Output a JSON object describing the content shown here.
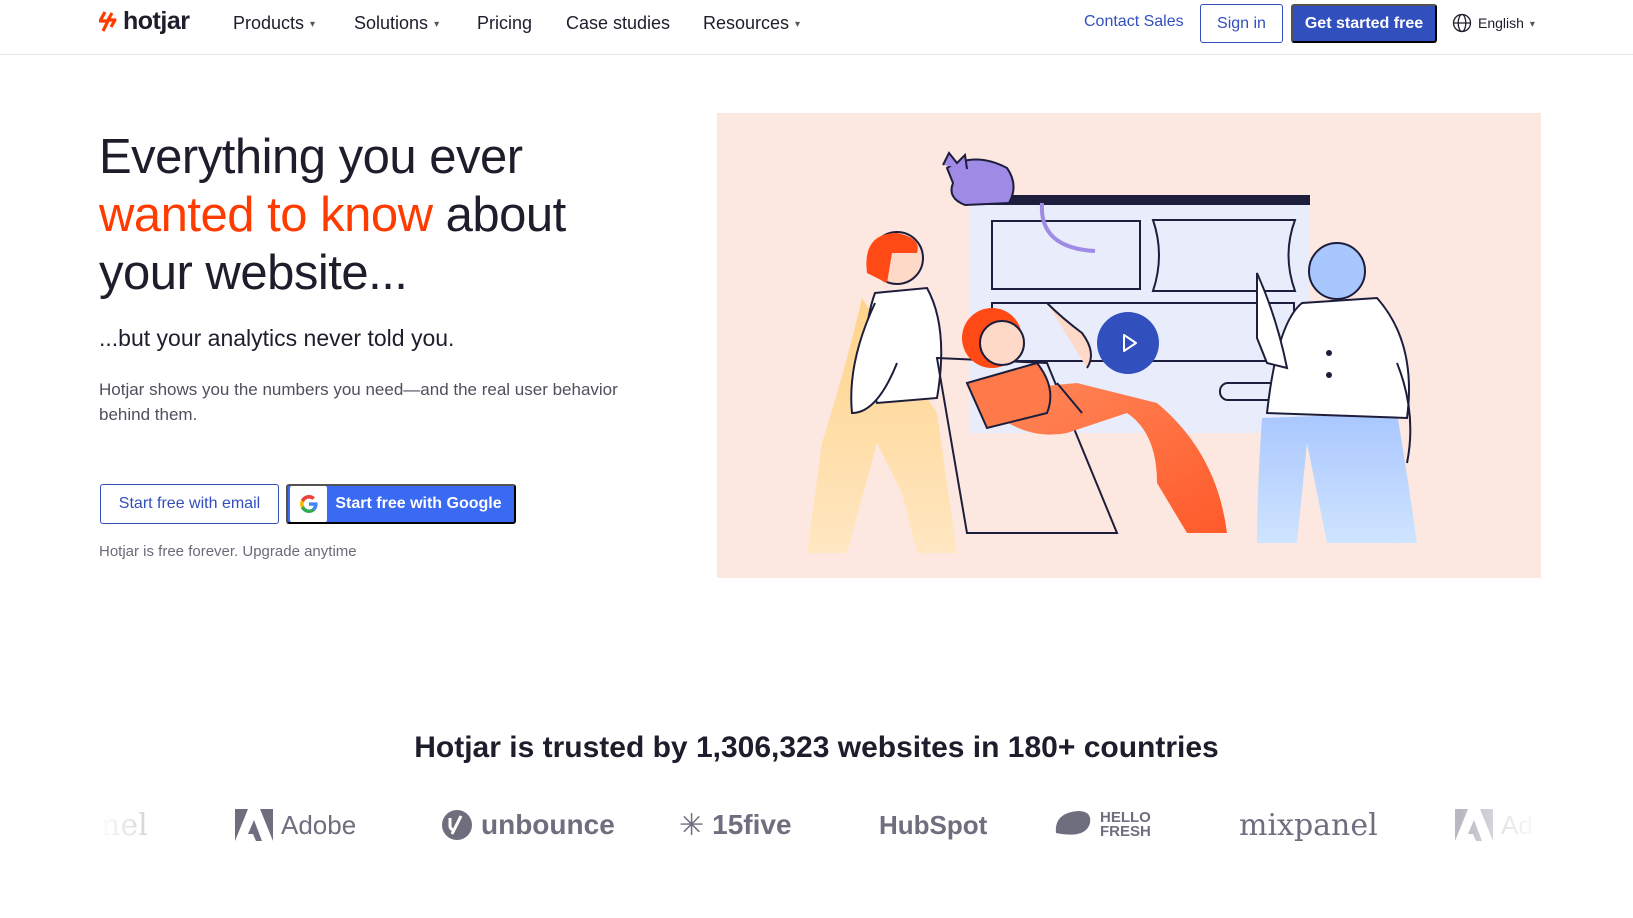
{
  "nav": {
    "logo_text": "hotjar",
    "links": [
      {
        "label": "Products",
        "dropdown": true
      },
      {
        "label": "Solutions",
        "dropdown": true
      },
      {
        "label": "Pricing",
        "dropdown": false
      },
      {
        "label": "Case studies",
        "dropdown": false
      },
      {
        "label": "Resources",
        "dropdown": true
      }
    ],
    "contact_sales": "Contact Sales",
    "sign_in": "Sign in",
    "get_started": "Get started free",
    "language": "English"
  },
  "hero": {
    "title_line1": "Everything you ever",
    "title_accent": "wanted to know",
    "title_rest": " about",
    "title_line3": "your website...",
    "subheading": "...but your analytics never told you.",
    "description": "Hotjar shows you the numbers you need—and the real user behavior behind them.",
    "btn_email": "Start free with email",
    "btn_google": "Start free with Google",
    "free_note": "Hotjar is free forever. Upgrade anytime"
  },
  "trust": {
    "headline": "Hotjar is trusted by 1,306,323 websites in 180+ countries",
    "logos": [
      "nel",
      "Adobe",
      "unbounce",
      "15five",
      "HubSpot",
      "HELLO FRESH",
      "mixpanel",
      "Ad"
    ]
  },
  "colors": {
    "brand_blue": "#324fbe",
    "google_blue": "#3a69f2",
    "accent_orange": "#ff3c00",
    "hero_bg": "#fde8e1"
  },
  "icons": [
    "hotjar-logo-icon",
    "chevron-down-icon",
    "globe-icon",
    "google-g-icon",
    "play-icon"
  ]
}
